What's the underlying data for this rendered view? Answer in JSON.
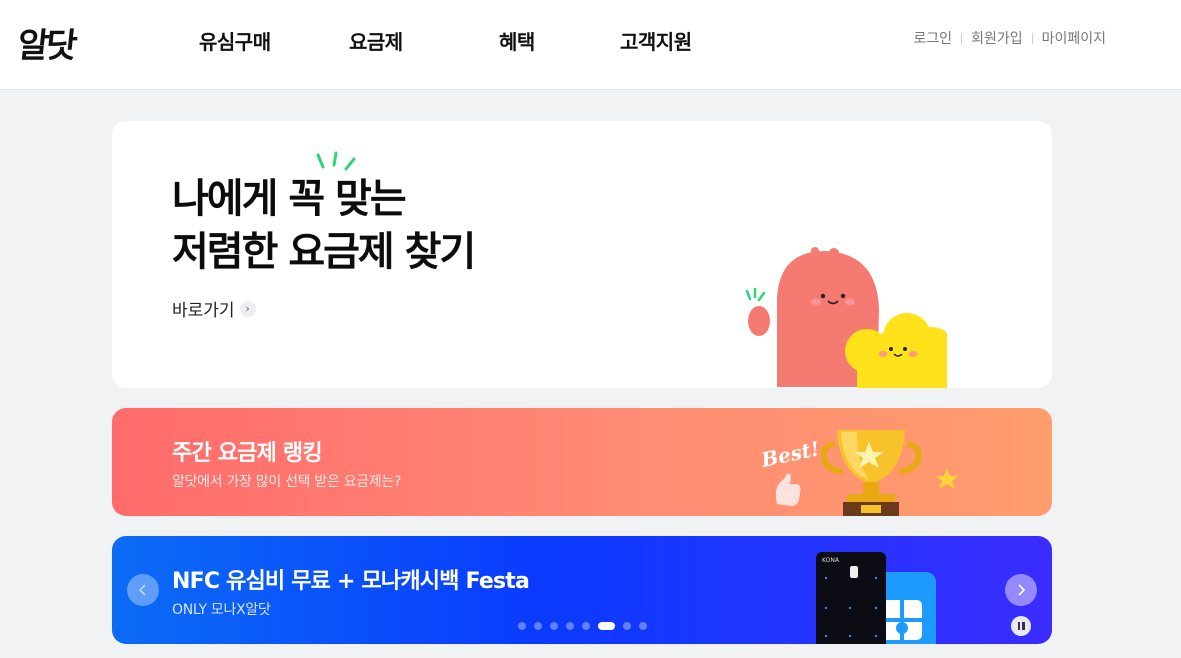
{
  "header": {
    "logo_text": "알닷",
    "nav": [
      "유심구매",
      "요금제",
      "혜택",
      "고객지원"
    ],
    "util": [
      "로그인",
      "회원가입",
      "마이페이지"
    ]
  },
  "hero": {
    "title_line1": "나에게 꼭 맞는",
    "title_line2": "저렴한 요금제 찾기",
    "link_label": "바로가기"
  },
  "ranking": {
    "title": "주간 요금제 랭킹",
    "subtitle": "알닷에서 가장 많이 선택 받은 요금제는?",
    "badge_text": "Best!"
  },
  "promo": {
    "title": "NFC 유심비 무료 + 모나캐시백 Festa",
    "subtitle": "ONLY 모나X알닷",
    "card_brand": "KONA",
    "slide_count": 8,
    "active_slide": 6
  },
  "colors": {
    "ranking_gradient": [
      "#ff6b6b",
      "#ff9d6c"
    ],
    "promo_gradient": [
      "#0b6cf5",
      "#3a2cff"
    ],
    "mascot_pink": "#f47a72",
    "mascot_yellow": "#ffe21a"
  }
}
